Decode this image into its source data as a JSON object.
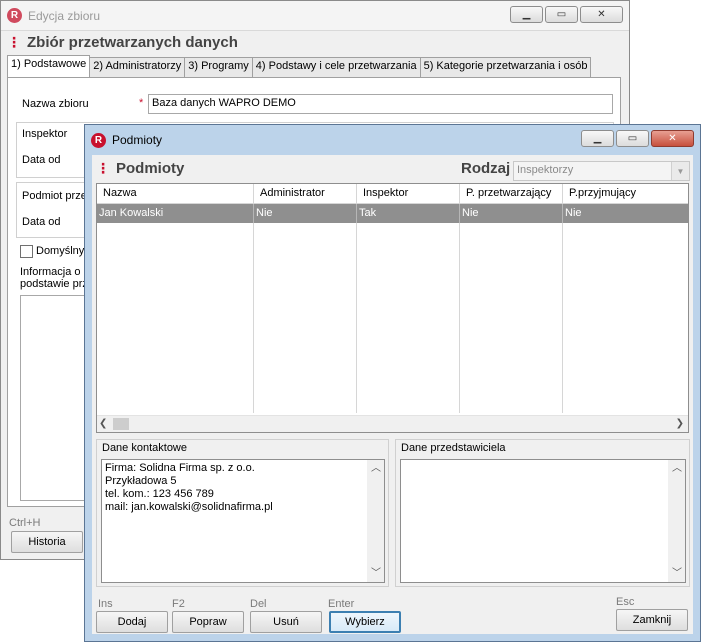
{
  "background_window": {
    "title": "Edycja zbioru",
    "header": "Zbiór przetwarzanych danych",
    "tabs": [
      "1) Podstawowe",
      "2) Administratorzy",
      "3) Programy",
      "4) Podstawy i cele przetwarzania",
      "5) Kategorie przetwarzania i osób"
    ],
    "fields": {
      "nazwa_label": "Nazwa zbioru",
      "nazwa_value": "Baza danych WAPRO DEMO",
      "inspektor_label": "Inspektor",
      "data_od_label_1": "Data od",
      "podmiot_label": "Podmiot prze",
      "data_od_label_2": "Data od",
      "domyslny_label": "Domyślny",
      "informacja_label_1": "Informacja o u",
      "informacja_label_2": "podstawie prze"
    },
    "footer": {
      "hotkey": "Ctrl+H",
      "historia_button": "Historia"
    }
  },
  "dialog": {
    "title": "Podmioty",
    "header": "Podmioty",
    "rodzaj_label": "Rodzaj",
    "rodzaj_value": "Inspektorzy",
    "columns": [
      "Nazwa",
      "Administrator",
      "Inspektor",
      "P. przetwarzający",
      "P.przyjmujący"
    ],
    "rows": [
      [
        "Jan Kowalski",
        "Nie",
        "Tak",
        "Nie",
        "Nie"
      ]
    ],
    "dane_kontaktowe": {
      "label": "Dane kontaktowe",
      "lines": [
        "Firma: Solidna Firma sp. z o.o.",
        "Przykładowa 5",
        "tel. kom.: 123 456 789",
        "mail: jan.kowalski@solidnafirma.pl"
      ]
    },
    "dane_przedstawiciela": {
      "label": "Dane przedstawiciela"
    },
    "buttons": {
      "dodaj_hotkey": "Ins",
      "dodaj": "Dodaj",
      "popraw_hotkey": "F2",
      "popraw": "Popraw",
      "usun_hotkey": "Del",
      "usun": "Usuń",
      "wybierz_hotkey": "Enter",
      "wybierz": "Wybierz",
      "zamknij_hotkey": "Esc",
      "zamknij": "Zamknij"
    }
  }
}
